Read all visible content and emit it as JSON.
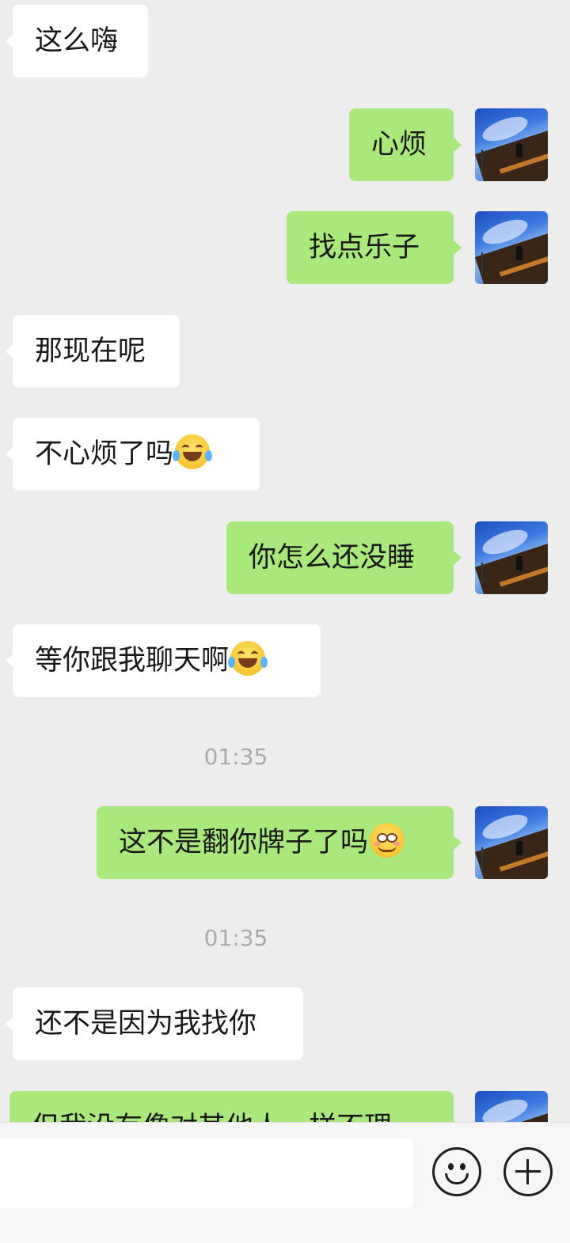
{
  "messages": [
    {
      "side": "in",
      "text": "这么嗨"
    },
    {
      "side": "out",
      "text": "心烦"
    },
    {
      "side": "out",
      "text": "找点乐子"
    },
    {
      "side": "in",
      "text": "那现在呢"
    },
    {
      "side": "in",
      "text": "不心烦了吗",
      "emoji": "laugh-cry-emoji"
    },
    {
      "side": "out",
      "text": "你怎么还没睡"
    },
    {
      "side": "in",
      "text": "等你跟我聊天啊",
      "emoji": "laugh-cry-emoji"
    },
    {
      "type": "time",
      "text": "01:35"
    },
    {
      "side": "out",
      "text": "这不是翻你牌子了吗",
      "emoji": "smirk-emoji"
    },
    {
      "type": "time",
      "text": "01:35"
    },
    {
      "side": "in",
      "text": "还不是因为我找你"
    },
    {
      "side": "out",
      "text": "但我没有像对其他人一样不理"
    }
  ],
  "input": {
    "value": "",
    "placeholder": ""
  },
  "icons": {
    "emoji_button": "smile-icon",
    "more_button": "plus-circle-icon"
  },
  "colors": {
    "background": "#ededed",
    "outgoing_bubble": "#a9e87a",
    "incoming_bubble": "#ffffff",
    "time_text": "#a9a9a9"
  }
}
